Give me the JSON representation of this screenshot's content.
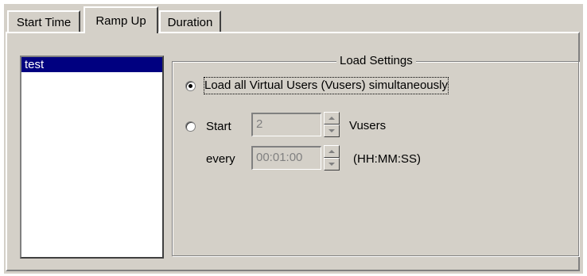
{
  "tabs": [
    {
      "label": "Start Time",
      "active": false
    },
    {
      "label": "Ramp Up",
      "active": true
    },
    {
      "label": "Duration",
      "active": false
    }
  ],
  "scenario_list": {
    "items": [
      {
        "label": "test",
        "selected": true
      }
    ]
  },
  "load_settings": {
    "title": "Load Settings",
    "option_all": {
      "label": "Load all Virtual Users (Vusers) simultaneously",
      "selected": true
    },
    "option_start": {
      "label": "Start",
      "selected": false,
      "count_value": "2",
      "count_unit": "Vusers",
      "every_label": "every",
      "interval_value": "00:01:00",
      "interval_format": "(HH:MM:SS)"
    }
  },
  "colors": {
    "face": "#d4d0c8",
    "selection": "#000080",
    "disabled_text": "#808080"
  }
}
